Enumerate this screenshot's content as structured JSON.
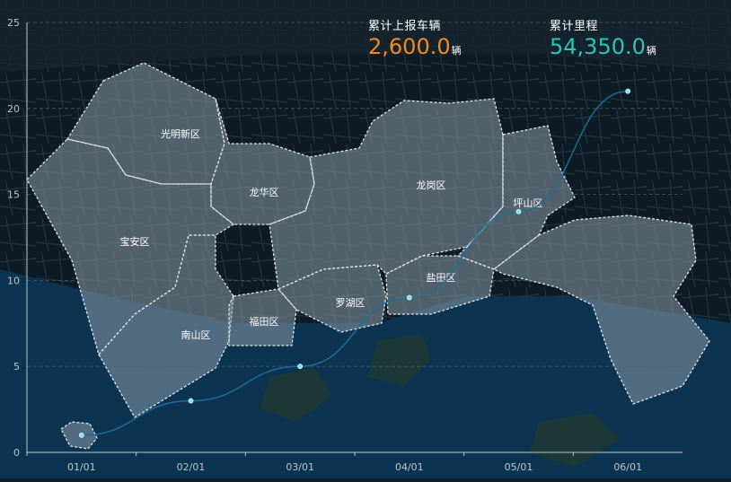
{
  "kpis": {
    "vehicles": {
      "label": "累计上报车辆",
      "value": "2,600.0",
      "unit": "辆"
    },
    "mileage": {
      "label": "累计里程",
      "value": "54,350.0",
      "unit": "辆"
    }
  },
  "districts": [
    {
      "name": "光明新区"
    },
    {
      "name": "龙华区"
    },
    {
      "name": "宝安区"
    },
    {
      "name": "南山区"
    },
    {
      "name": "福田区"
    },
    {
      "name": "罗湖区"
    },
    {
      "name": "盐田区"
    },
    {
      "name": "龙岗区"
    },
    {
      "name": "坪山区"
    }
  ],
  "colors": {
    "background": "#0b1e2c",
    "sea": "#0c3350",
    "land": "#1a2a34",
    "district_fill": "#8a9ba8",
    "district_border": "#dfe6ea",
    "line": "#1f6f9a",
    "point": "#7fe3ff",
    "vehicles": "#f08a24",
    "mileage": "#2ec4b6"
  },
  "chart_data": {
    "type": "line",
    "categories": [
      "01/01",
      "02/01",
      "03/01",
      "04/01",
      "05/01",
      "06/01"
    ],
    "series": [
      {
        "values": [
          1,
          3,
          5,
          9,
          14,
          21
        ]
      }
    ],
    "ylim": [
      0,
      25
    ],
    "yticks": [
      0,
      5,
      10,
      15,
      20,
      25
    ],
    "grid": true
  }
}
